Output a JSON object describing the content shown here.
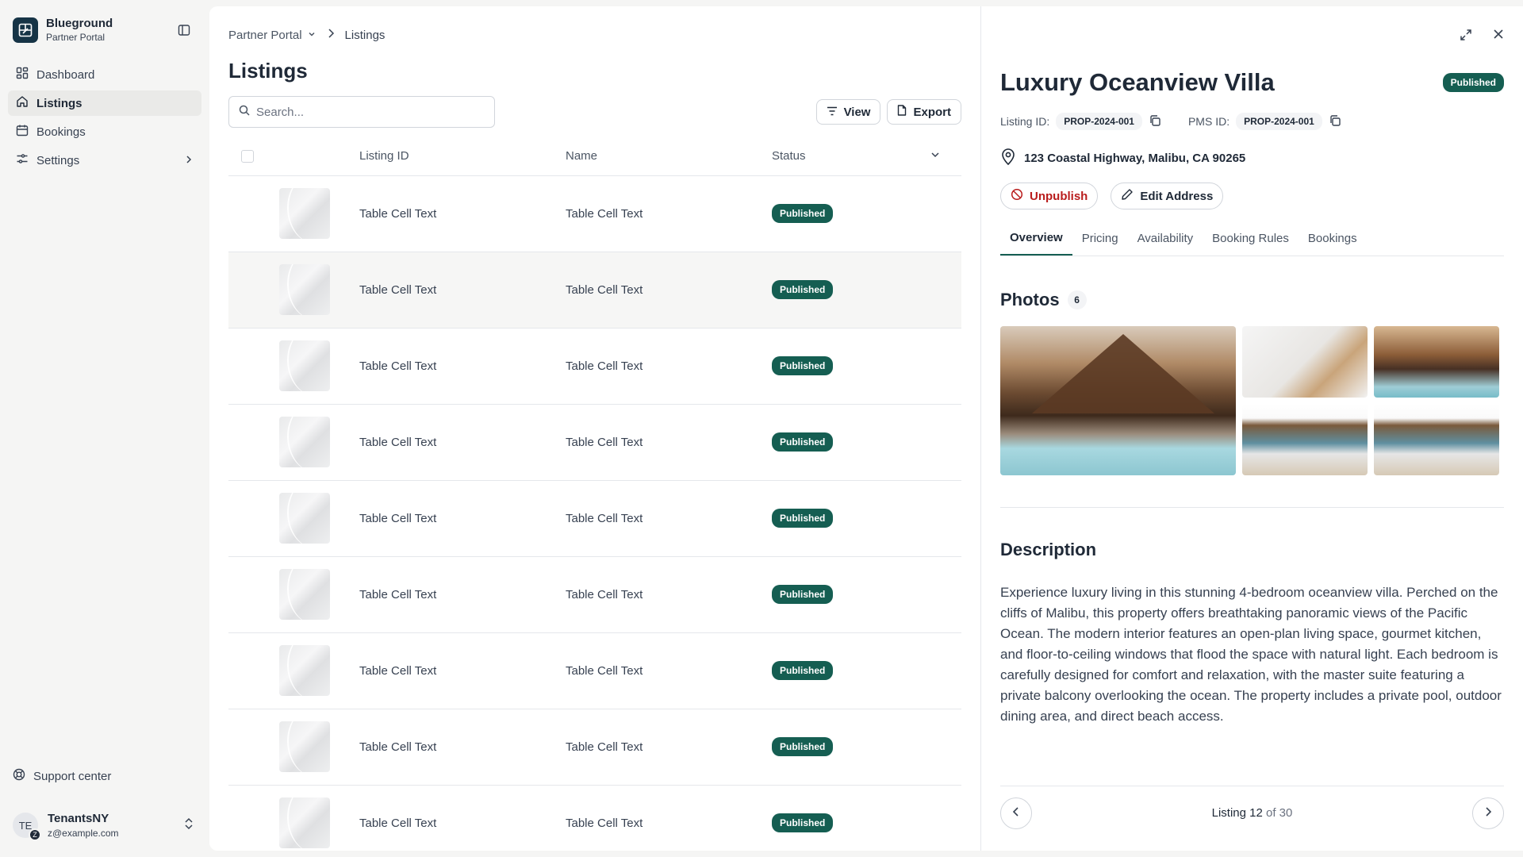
{
  "brand": {
    "name": "Blueground",
    "subtitle": "Partner Portal"
  },
  "sidebar": {
    "items": [
      {
        "label": "Dashboard",
        "icon": "dashboard-icon"
      },
      {
        "label": "Listings",
        "icon": "home-icon",
        "active": true
      },
      {
        "label": "Bookings",
        "icon": "calendar-icon"
      },
      {
        "label": "Settings",
        "icon": "settings-sliders-icon"
      }
    ],
    "support": "Support center",
    "user": {
      "initials": "TE",
      "badge": "Z",
      "name": "TenantsNY",
      "email": "z@example.com"
    }
  },
  "breadcrumb": {
    "parent": "Partner Portal",
    "current": "Listings"
  },
  "page": {
    "title": "Listings"
  },
  "toolbar": {
    "search_placeholder": "Search...",
    "view_label": "View",
    "export_label": "Export"
  },
  "table": {
    "columns": [
      "Listing ID",
      "Name",
      "Status"
    ],
    "rows": [
      {
        "listing_id": "Table Cell Text",
        "name": "Table Cell Text",
        "status": "Published"
      },
      {
        "listing_id": "Table Cell Text",
        "name": "Table Cell Text",
        "status": "Published"
      },
      {
        "listing_id": "Table Cell Text",
        "name": "Table Cell Text",
        "status": "Published"
      },
      {
        "listing_id": "Table Cell Text",
        "name": "Table Cell Text",
        "status": "Published"
      },
      {
        "listing_id": "Table Cell Text",
        "name": "Table Cell Text",
        "status": "Published"
      },
      {
        "listing_id": "Table Cell Text",
        "name": "Table Cell Text",
        "status": "Published"
      },
      {
        "listing_id": "Table Cell Text",
        "name": "Table Cell Text",
        "status": "Published"
      },
      {
        "listing_id": "Table Cell Text",
        "name": "Table Cell Text",
        "status": "Published"
      },
      {
        "listing_id": "Table Cell Text",
        "name": "Table Cell Text",
        "status": "Published"
      }
    ]
  },
  "detail": {
    "title": "Luxury Oceanview Villa",
    "status": "Published",
    "listing_id_label": "Listing ID:",
    "listing_id": "PROP-2024-001",
    "pms_id_label": "PMS ID:",
    "pms_id": "PROP-2024-001",
    "address": "123 Coastal Highway, Malibu, CA 90265",
    "unpublish_label": "Unpublish",
    "edit_address_label": "Edit Address",
    "tabs": [
      "Overview",
      "Pricing",
      "Availability",
      "Booking Rules",
      "Bookings"
    ],
    "photos_title": "Photos",
    "photos_count": "6",
    "description_title": "Description",
    "description": "Experience luxury living in this stunning 4-bedroom oceanview villa. Perched on the cliffs of Malibu, this property offers breathtaking panoramic views of the Pacific Ocean. The modern interior features an open-plan living space, gourmet kitchen, and floor-to-ceiling windows that flood the space with natural light. Each bedroom is carefully designed for comfort and relaxation, with the master suite featuring a private balcony overlooking the ocean. The property includes a private pool, outdoor dining area, and direct beach access.",
    "pager": {
      "prefix": "Listing",
      "current": "12",
      "suffix": "of 30"
    }
  },
  "colors": {
    "accent": "#155e52",
    "brand": "#163446",
    "danger": "#b91c1c"
  }
}
